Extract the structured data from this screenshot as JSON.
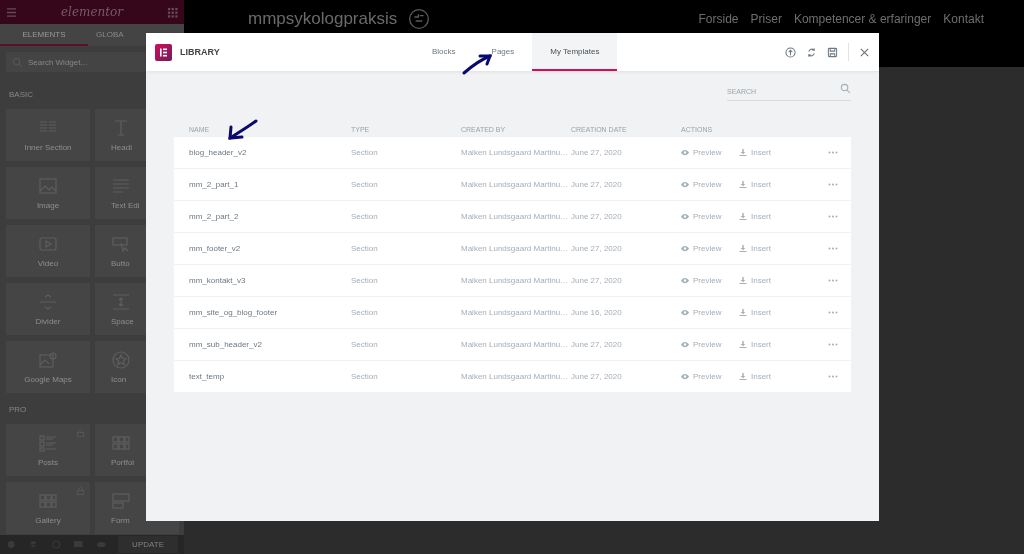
{
  "editor_panel": {
    "logo": "elementor",
    "tabs": [
      {
        "label": "ELEMENTS",
        "selected": true
      },
      {
        "label": "GLOBA",
        "selected": false
      }
    ],
    "search": {
      "placeholder": "Search Widget..."
    },
    "sections": [
      {
        "title": "BASIC",
        "widgets": [
          {
            "label": "Inner Section",
            "kind": "columns",
            "locked": false
          },
          {
            "label": "Headi",
            "kind": "heading"
          },
          {
            "label": "Image",
            "kind": "image",
            "locked": false
          },
          {
            "label": "Text Edi",
            "kind": "text"
          },
          {
            "label": "Video",
            "kind": "video",
            "locked": false
          },
          {
            "label": "Butto",
            "kind": "button"
          },
          {
            "label": "Divider",
            "kind": "divider",
            "locked": false
          },
          {
            "label": "Space",
            "kind": "spacer"
          },
          {
            "label": "Google Maps",
            "kind": "map",
            "locked": false
          },
          {
            "label": "Icon",
            "kind": "star"
          }
        ]
      },
      {
        "title": "PRO",
        "widgets": [
          {
            "label": "Posts",
            "kind": "posts",
            "locked": true
          },
          {
            "label": "Portfol",
            "kind": "grid"
          },
          {
            "label": "Gallery",
            "kind": "grid",
            "locked": true
          },
          {
            "label": "Form",
            "kind": "form"
          }
        ]
      }
    ],
    "update_button": "UPDATE"
  },
  "site": {
    "title": "mmpsykologpraksis",
    "nav": [
      "Forside",
      "Priser",
      "Kompetencer & erfaringer",
      "Kontakt"
    ]
  },
  "library": {
    "title": "LIBRARY",
    "tabs": [
      {
        "label": "Blocks",
        "selected": false
      },
      {
        "label": "Pages",
        "selected": false
      },
      {
        "label": "My Templates",
        "selected": true
      }
    ],
    "search": {
      "placeholder": "SEARCH"
    },
    "columns": [
      "NAME",
      "TYPE",
      "CREATED BY",
      "CREATION DATE",
      "ACTIONS"
    ],
    "rows": [
      {
        "name": "blog_header_v2",
        "type": "Section",
        "created_by": "Maiken Lundsgaard Martinu…",
        "date": "June 27, 2020",
        "preview": "Preview",
        "insert": "Insert"
      },
      {
        "name": "mm_2_part_1",
        "type": "Section",
        "created_by": "Maiken Lundsgaard Martinu…",
        "date": "June 27, 2020",
        "preview": "Preview",
        "insert": "Insert"
      },
      {
        "name": "mm_2_part_2",
        "type": "Section",
        "created_by": "Maiken Lundsgaard Martinu…",
        "date": "June 27, 2020",
        "preview": "Preview",
        "insert": "Insert"
      },
      {
        "name": "mm_footer_v2",
        "type": "Section",
        "created_by": "Maiken Lundsgaard Martinu…",
        "date": "June 27, 2020",
        "preview": "Preview",
        "insert": "Insert"
      },
      {
        "name": "mm_kontakt_v3",
        "type": "Section",
        "created_by": "Maiken Lundsgaard Martinu…",
        "date": "June 27, 2020",
        "preview": "Preview",
        "insert": "Insert"
      },
      {
        "name": "mm_site_og_blog_footer",
        "type": "Section",
        "created_by": "Maiken Lundsgaard Martinu…",
        "date": "June 16, 2020",
        "preview": "Preview",
        "insert": "Insert"
      },
      {
        "name": "mm_sub_header_v2",
        "type": "Section",
        "created_by": "Maiken Lundsgaard Martinu…",
        "date": "June 27, 2020",
        "preview": "Preview",
        "insert": "Insert"
      },
      {
        "name": "text_temp",
        "type": "Section",
        "created_by": "Maiken Lundsgaard Martinu…",
        "date": "June 27, 2020",
        "preview": "Preview",
        "insert": "Insert"
      }
    ]
  }
}
